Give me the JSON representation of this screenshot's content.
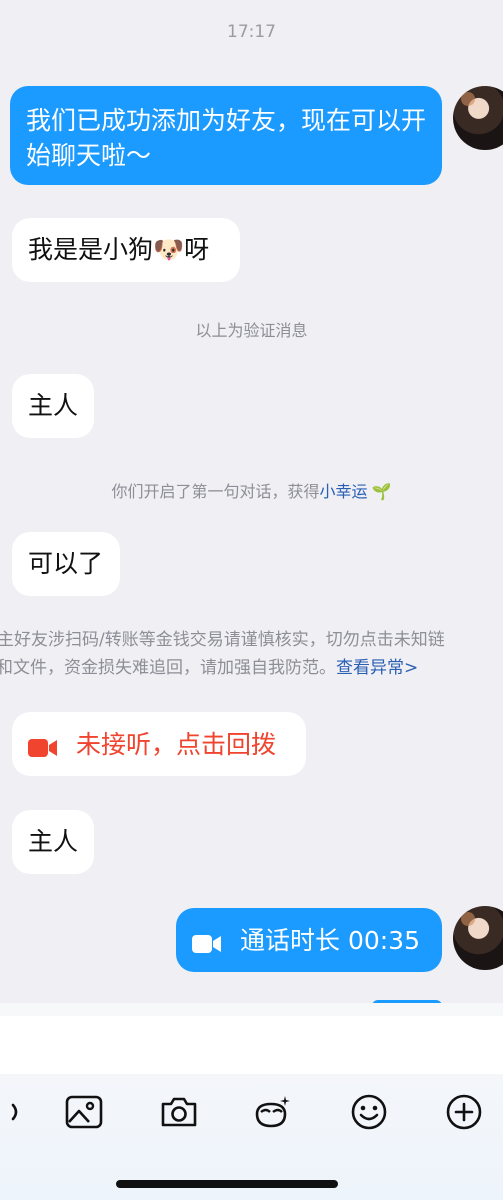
{
  "status": {
    "time": "17:17"
  },
  "messages": {
    "m1": "我们已成功添加为好友，现在可以开始聊天啦～",
    "m2_text": "我是是小狗",
    "m2_emoji": "🐶",
    "m2_tail": "呀",
    "verify_note": "以上为验证消息",
    "m3": "主人",
    "first_talk_prefix": "你们开启了第一句对话，获得",
    "first_talk_link": "小幸运",
    "first_talk_icon": "🌱",
    "m4": "可以了",
    "warning_line1": "主好友涉扫码/转账等金钱交易请谨慎核实，切勿点击未知链",
    "warning_line2_text": "和文件，资金损失难追回，请加强自我防范。",
    "warning_link": "查看异常>",
    "missed_call": "未接听，点击回拨",
    "m5": "主人",
    "call_duration": "通话时长 00:35"
  },
  "colors": {
    "accent_blue": "#1b9aff",
    "missed_red": "#f0442f",
    "link_blue": "#2a5fb4",
    "background": "#efeff4"
  },
  "toolbar": {
    "icons": [
      "voice-icon",
      "image-icon",
      "camera-icon",
      "sticker-icon",
      "emoji-icon",
      "plus-icon"
    ]
  }
}
